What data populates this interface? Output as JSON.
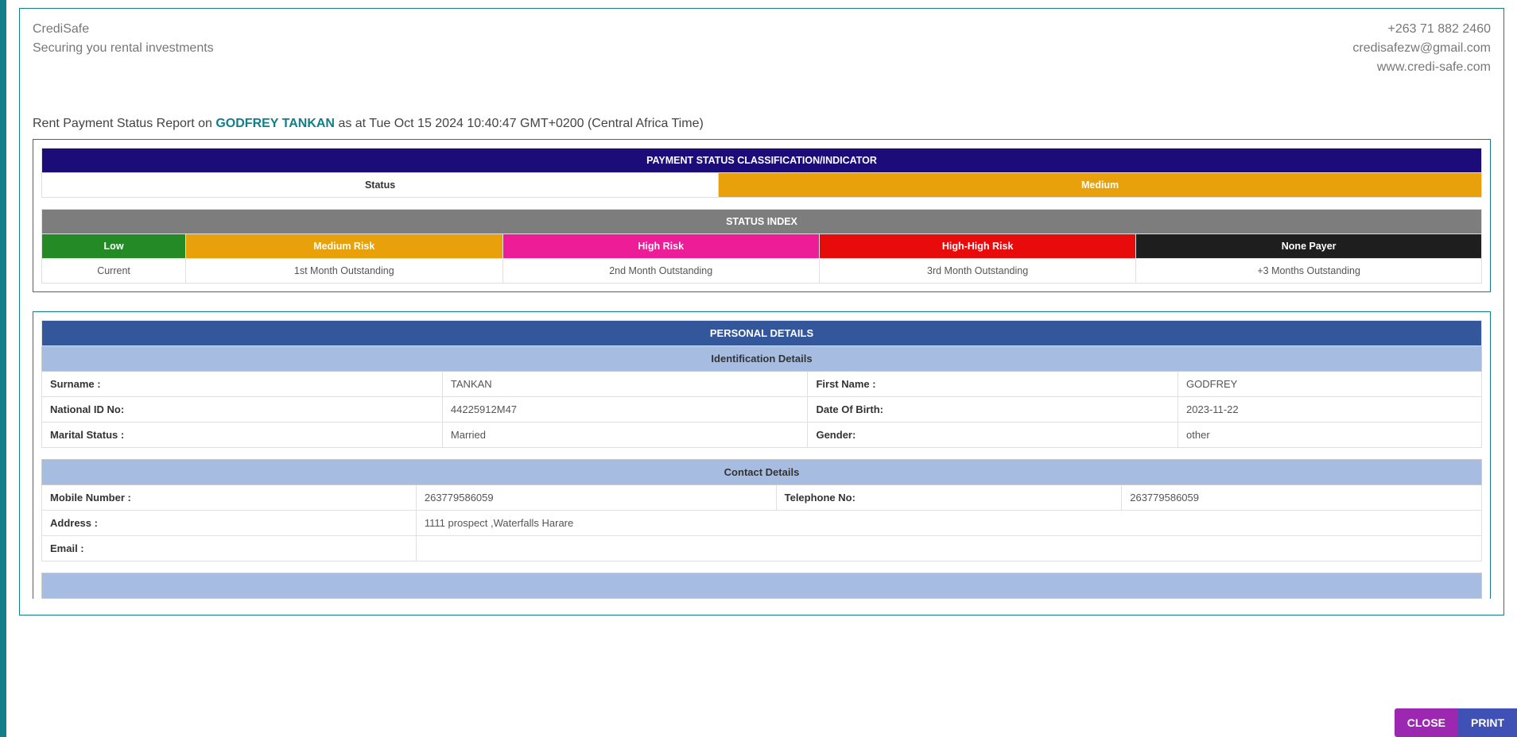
{
  "brand": {
    "name": "CrediSafe",
    "tagline": "Securing you rental investments"
  },
  "contact": {
    "phone": "+263 71 882 2460",
    "email": "credisafezw@gmail.com",
    "web": "www.credi-safe.com"
  },
  "report_title": {
    "prefix": "Rent Payment Status Report on ",
    "subject": "GODFREY TANKAN",
    "suffix": " as at Tue Oct 15 2024 10:40:47 GMT+0200 (Central Africa Time)"
  },
  "status": {
    "table_header": "PAYMENT STATUS CLASSIFICATION/INDICATOR",
    "label": "Status",
    "value": "Medium"
  },
  "index": {
    "header": "STATUS INDEX",
    "cols": [
      {
        "name": "Low",
        "desc": "Current",
        "cls": "c-green"
      },
      {
        "name": "Medium Risk",
        "desc": "1st Month Outstanding",
        "cls": "c-orange"
      },
      {
        "name": "High Risk",
        "desc": "2nd Month Outstanding",
        "cls": "c-pink"
      },
      {
        "name": "High-High Risk",
        "desc": "3rd Month Outstanding",
        "cls": "c-red"
      },
      {
        "name": "None Payer",
        "desc": "+3 Months Outstanding",
        "cls": "c-black"
      }
    ]
  },
  "personal": {
    "header": "PERSONAL DETAILS",
    "id_header": "Identification Details",
    "rows": {
      "surname_k": "Surname :",
      "surname_v": "TANKAN",
      "first_k": "First Name :",
      "first_v": "GODFREY",
      "nid_k": "National ID No:",
      "nid_v": "44225912M47",
      "dob_k": "Date Of Birth:",
      "dob_v": "2023-11-22",
      "ms_k": "Marital Status :",
      "ms_v": "Married",
      "gender_k": "Gender:",
      "gender_v": "other"
    }
  },
  "contact_details": {
    "header": "Contact Details",
    "rows": {
      "mob_k": "Mobile Number :",
      "mob_v": "263779586059",
      "tel_k": "Telephone No:",
      "tel_v": "263779586059",
      "addr_k": "Address :",
      "addr_v": "1111 prospect ,Waterfalls Harare",
      "email_k": "Email :",
      "email_v": ""
    }
  },
  "footer": {
    "close": "CLOSE",
    "print": "PRINT"
  }
}
